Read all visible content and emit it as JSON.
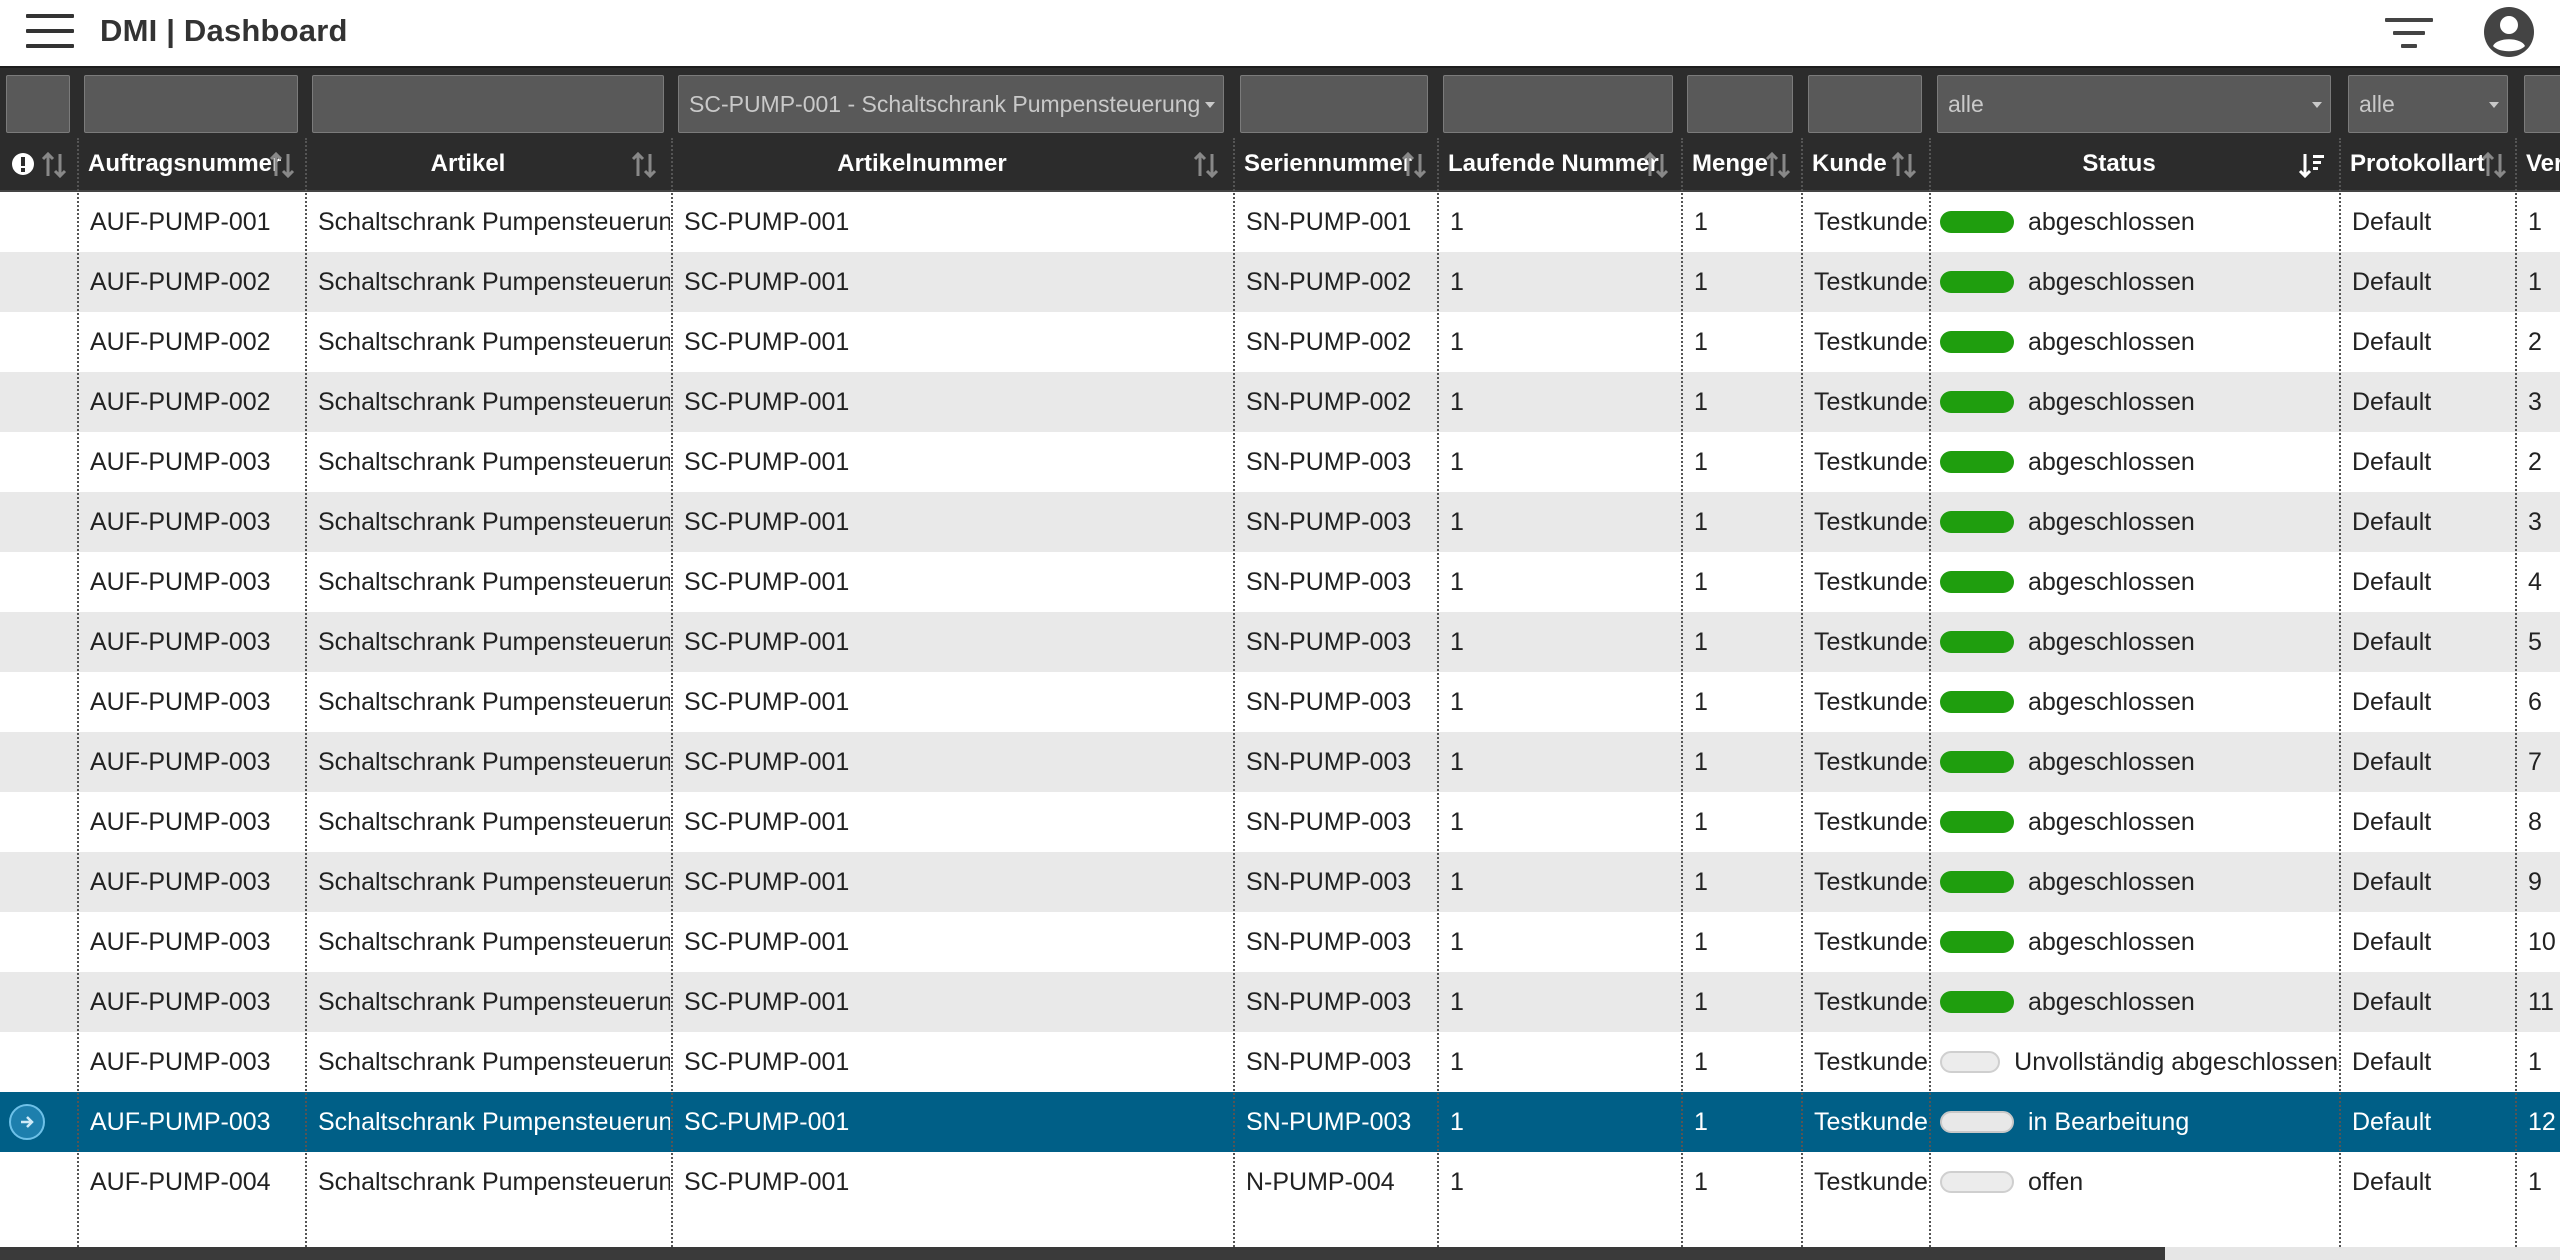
{
  "app": {
    "title": "DMI | Dashboard"
  },
  "filters": {
    "artikelnummer_value": "SC-PUMP-001 - Schaltschrank Pumpensteuerung",
    "status_value": "alle",
    "protokollart_value": "alle"
  },
  "columns": {
    "auftragsnummer": "Auftragsnummer",
    "artikel": "Artikel",
    "artikelnummer": "Artikelnummer",
    "seriennummer": "Seriennummer",
    "laufende_nummer": "Laufende Nummer",
    "menge": "Menge",
    "kunde": "Kunde",
    "status": "Status",
    "protokollart": "Protokollart",
    "version_partial": "Ver"
  },
  "colors": {
    "header_bg": "#2c2c2c",
    "row_alt_bg": "#e9e9e9",
    "selected_row_bg": "#005f87",
    "status_done": "#1f9e0e",
    "status_open": "#ececec"
  },
  "rows": [
    {
      "auftrag": "AUF-PUMP-001",
      "artikel": "Schaltschrank Pumpensteuerung",
      "artnr": "SC-PUMP-001",
      "serien": "SN-PUMP-001",
      "lfd": "1",
      "menge": "1",
      "kunde": "Testkunde",
      "status": "abgeschlossen",
      "status_type": "done",
      "protokoll": "Default",
      "ver": "1"
    },
    {
      "auftrag": "AUF-PUMP-002",
      "artikel": "Schaltschrank Pumpensteuerung",
      "artnr": "SC-PUMP-001",
      "serien": "SN-PUMP-002",
      "lfd": "1",
      "menge": "1",
      "kunde": "Testkunde",
      "status": "abgeschlossen",
      "status_type": "done",
      "protokoll": "Default",
      "ver": "1"
    },
    {
      "auftrag": "AUF-PUMP-002",
      "artikel": "Schaltschrank Pumpensteuerung",
      "artnr": "SC-PUMP-001",
      "serien": "SN-PUMP-002",
      "lfd": "1",
      "menge": "1",
      "kunde": "Testkunde",
      "status": "abgeschlossen",
      "status_type": "done",
      "protokoll": "Default",
      "ver": "2"
    },
    {
      "auftrag": "AUF-PUMP-002",
      "artikel": "Schaltschrank Pumpensteuerung",
      "artnr": "SC-PUMP-001",
      "serien": "SN-PUMP-002",
      "lfd": "1",
      "menge": "1",
      "kunde": "Testkunde",
      "status": "abgeschlossen",
      "status_type": "done",
      "protokoll": "Default",
      "ver": "3"
    },
    {
      "auftrag": "AUF-PUMP-003",
      "artikel": "Schaltschrank Pumpensteuerung",
      "artnr": "SC-PUMP-001",
      "serien": "SN-PUMP-003",
      "lfd": "1",
      "menge": "1",
      "kunde": "Testkunde",
      "status": "abgeschlossen",
      "status_type": "done",
      "protokoll": "Default",
      "ver": "2"
    },
    {
      "auftrag": "AUF-PUMP-003",
      "artikel": "Schaltschrank Pumpensteuerung",
      "artnr": "SC-PUMP-001",
      "serien": "SN-PUMP-003",
      "lfd": "1",
      "menge": "1",
      "kunde": "Testkunde",
      "status": "abgeschlossen",
      "status_type": "done",
      "protokoll": "Default",
      "ver": "3"
    },
    {
      "auftrag": "AUF-PUMP-003",
      "artikel": "Schaltschrank Pumpensteuerung",
      "artnr": "SC-PUMP-001",
      "serien": "SN-PUMP-003",
      "lfd": "1",
      "menge": "1",
      "kunde": "Testkunde",
      "status": "abgeschlossen",
      "status_type": "done",
      "protokoll": "Default",
      "ver": "4"
    },
    {
      "auftrag": "AUF-PUMP-003",
      "artikel": "Schaltschrank Pumpensteuerung",
      "artnr": "SC-PUMP-001",
      "serien": "SN-PUMP-003",
      "lfd": "1",
      "menge": "1",
      "kunde": "Testkunde",
      "status": "abgeschlossen",
      "status_type": "done",
      "protokoll": "Default",
      "ver": "5"
    },
    {
      "auftrag": "AUF-PUMP-003",
      "artikel": "Schaltschrank Pumpensteuerung",
      "artnr": "SC-PUMP-001",
      "serien": "SN-PUMP-003",
      "lfd": "1",
      "menge": "1",
      "kunde": "Testkunde",
      "status": "abgeschlossen",
      "status_type": "done",
      "protokoll": "Default",
      "ver": "6"
    },
    {
      "auftrag": "AUF-PUMP-003",
      "artikel": "Schaltschrank Pumpensteuerung",
      "artnr": "SC-PUMP-001",
      "serien": "SN-PUMP-003",
      "lfd": "1",
      "menge": "1",
      "kunde": "Testkunde",
      "status": "abgeschlossen",
      "status_type": "done",
      "protokoll": "Default",
      "ver": "7"
    },
    {
      "auftrag": "AUF-PUMP-003",
      "artikel": "Schaltschrank Pumpensteuerung",
      "artnr": "SC-PUMP-001",
      "serien": "SN-PUMP-003",
      "lfd": "1",
      "menge": "1",
      "kunde": "Testkunde",
      "status": "abgeschlossen",
      "status_type": "done",
      "protokoll": "Default",
      "ver": "8"
    },
    {
      "auftrag": "AUF-PUMP-003",
      "artikel": "Schaltschrank Pumpensteuerung",
      "artnr": "SC-PUMP-001",
      "serien": "SN-PUMP-003",
      "lfd": "1",
      "menge": "1",
      "kunde": "Testkunde",
      "status": "abgeschlossen",
      "status_type": "done",
      "protokoll": "Default",
      "ver": "9"
    },
    {
      "auftrag": "AUF-PUMP-003",
      "artikel": "Schaltschrank Pumpensteuerung",
      "artnr": "SC-PUMP-001",
      "serien": "SN-PUMP-003",
      "lfd": "1",
      "menge": "1",
      "kunde": "Testkunde",
      "status": "abgeschlossen",
      "status_type": "done",
      "protokoll": "Default",
      "ver": "10"
    },
    {
      "auftrag": "AUF-PUMP-003",
      "artikel": "Schaltschrank Pumpensteuerung",
      "artnr": "SC-PUMP-001",
      "serien": "SN-PUMP-003",
      "lfd": "1",
      "menge": "1",
      "kunde": "Testkunde",
      "status": "abgeschlossen",
      "status_type": "done",
      "protokoll": "Default",
      "ver": "11"
    },
    {
      "auftrag": "AUF-PUMP-003",
      "artikel": "Schaltschrank Pumpensteuerung",
      "artnr": "SC-PUMP-001",
      "serien": "SN-PUMP-003",
      "lfd": "1",
      "menge": "1",
      "kunde": "Testkunde",
      "status": "Unvollständig abgeschlossen",
      "status_type": "open",
      "protokoll": "Default",
      "ver": "1"
    },
    {
      "auftrag": "AUF-PUMP-003",
      "artikel": "Schaltschrank Pumpensteuerung",
      "artnr": "SC-PUMP-001",
      "serien": "SN-PUMP-003",
      "lfd": "1",
      "menge": "1",
      "kunde": "Testkunde",
      "status": "in Bearbeitung",
      "status_type": "open",
      "protokoll": "Default",
      "ver": "12",
      "selected": true
    },
    {
      "auftrag": "AUF-PUMP-004",
      "artikel": "Schaltschrank Pumpensteuerung",
      "artnr": "SC-PUMP-001",
      "serien": "N-PUMP-004",
      "lfd": "1",
      "menge": "1",
      "kunde": "Testkunde",
      "status": "offen",
      "status_type": "open",
      "protokoll": "Default",
      "ver": "1"
    }
  ]
}
